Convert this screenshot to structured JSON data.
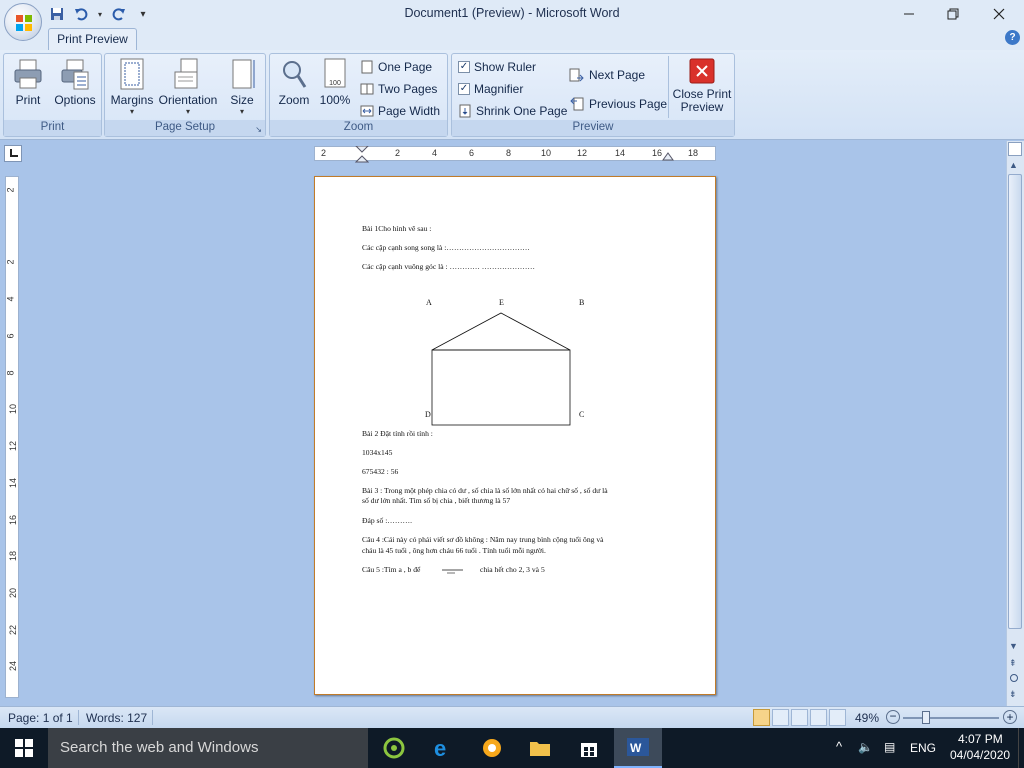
{
  "window": {
    "title": "Document1 (Preview) - Microsoft Word"
  },
  "ribbon": {
    "tab": "Print Preview",
    "groups": {
      "print": {
        "label": "Print",
        "print": "Print",
        "options": "Options"
      },
      "page_setup": {
        "label": "Page Setup",
        "margins": "Margins",
        "orientation": "Orientation",
        "size": "Size"
      },
      "zoom": {
        "label": "Zoom",
        "zoom": "Zoom",
        "hundred": "100%",
        "one_page": "One Page",
        "two_pages": "Two Pages",
        "page_width": "Page Width"
      },
      "preview": {
        "label": "Preview",
        "show_ruler": "Show Ruler",
        "magnifier": "Magnifier",
        "shrink_one_page": "Shrink One Page",
        "next_page": "Next Page",
        "previous_page": "Previous Page",
        "close_preview": "Close Print Preview"
      }
    }
  },
  "ruler": {
    "h_numbers": [
      "2",
      "2",
      "4",
      "6",
      "8",
      "10",
      "12",
      "14",
      "16",
      "18"
    ],
    "v_numbers": [
      "2",
      "2",
      "4",
      "6",
      "8",
      "10",
      "12",
      "14",
      "16",
      "18",
      "20",
      "22",
      "24"
    ]
  },
  "document": {
    "lines": [
      "Bài 1Cho hình vẽ sau :",
      "Các cặp cạnh song song là :……………………………",
      "Các cặp cạnh vuông góc là : ………… …………………",
      "Bài 2 Đặt tính rồi tính :",
      "1034x145",
      "675432 : 56",
      "Bài 3 : Trong một phép chia có dư , số chia là số lớn nhất có hai chữ số , số dư là",
      "số dư lớn nhất. Tìm số bị chia , biết thương là 57",
      "Đáp số :……….",
      "Câu 4 :Cái này có phải viết sơ đồ không : Năm nay trung bình cộng tuổi ông và",
      "cháu là 45 tuổi , ông hơn cháu 66 tuổi . Tính tuổi mỗi người.",
      "Câu 5 :Tìm a , b để",
      "chia hết cho 2, 3 và 5"
    ],
    "figure_labels": [
      "A",
      "E",
      "B",
      "D",
      "C"
    ]
  },
  "status": {
    "page": "Page: 1 of 1",
    "words": "Words: 127",
    "zoom": "49%"
  },
  "taskbar": {
    "search_placeholder": "Search the web and Windows",
    "lang": "ENG",
    "time": "4:07 PM",
    "date": "04/04/2020"
  },
  "colors": {
    "ribbon_bg": "#d3e2f5",
    "workspace": "#a9c4e9",
    "taskbar": "#0e1a27",
    "close_red": "#d9312b"
  }
}
